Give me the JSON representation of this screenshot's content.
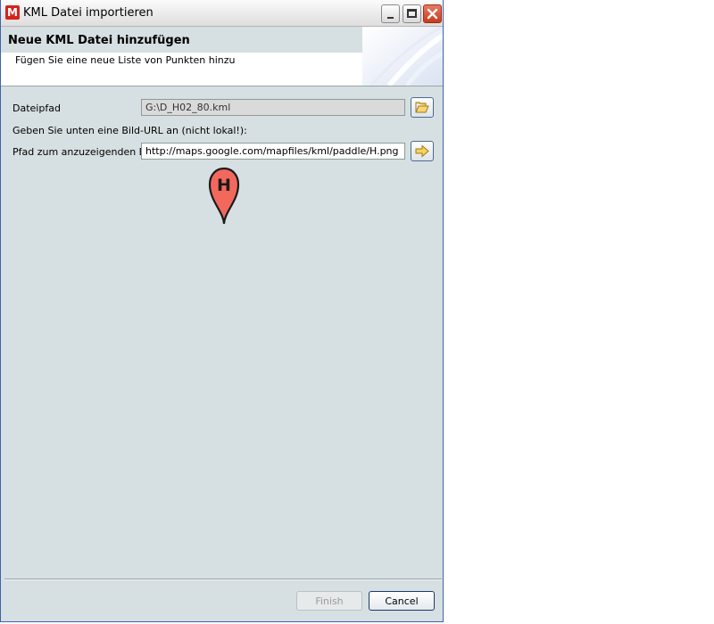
{
  "window": {
    "title": "KML Datei importieren",
    "app_icon_letter": "M"
  },
  "header": {
    "title": "Neue KML Datei hinzufügen",
    "description": "Fügen Sie eine neue Liste von Punkten hinzu"
  },
  "form": {
    "file_path_label": "Dateipfad",
    "file_path_value": "G:\\D_H02_80.kml",
    "hint_text": "Geben Sie unten eine Bild-URL an (nicht lokal!):",
    "image_path_label": "Pfad zum anzuzeigenden Bild",
    "image_path_value": "http://maps.google.com/mapfiles/kml/paddle/H.png"
  },
  "preview": {
    "marker_letter": "H",
    "marker_color": "#f2685c"
  },
  "buttons": {
    "finish_label": "Finish",
    "cancel_label": "Cancel"
  },
  "icons": {
    "browse": "folder-open-icon",
    "apply": "arrow-right-icon",
    "minimize": "minimize-icon",
    "maximize": "maximize-icon",
    "close": "close-icon"
  }
}
